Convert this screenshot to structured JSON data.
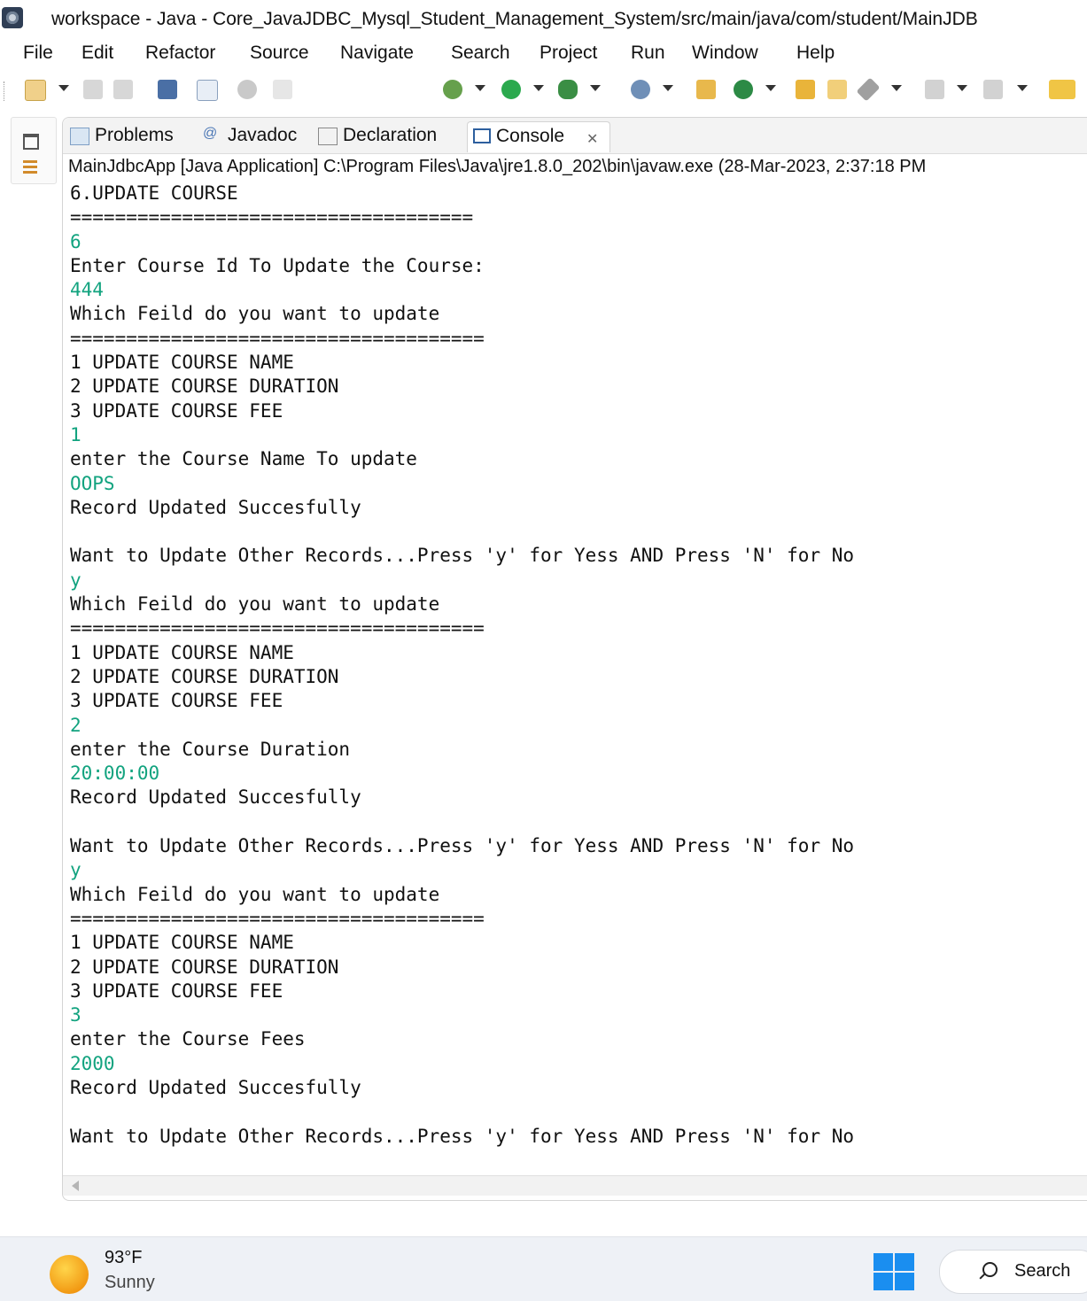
{
  "window": {
    "title": "workspace - Java - Core_JavaJDBC_Mysql_Student_Management_System/src/main/java/com/student/MainJDB"
  },
  "menubar": [
    "File",
    "Edit",
    "Refactor",
    "Source",
    "Navigate",
    "Search",
    "Project",
    "Run",
    "Window",
    "Help"
  ],
  "toolbar": {
    "icons": [
      "new-icon",
      "save-icon",
      "save-all-icon",
      "terminal-icon",
      "skip-breakpoints-icon",
      "pin-icon",
      "annotation-icon",
      "debug-icon",
      "run-icon",
      "external-tools-icon",
      "search-icon",
      "new-java-class-icon",
      "open-type-icon",
      "open-task-icon",
      "back-icon"
    ]
  },
  "tabs": [
    {
      "label": "Problems",
      "icon": "problems-icon"
    },
    {
      "label": "Javadoc",
      "icon": "javadoc-icon"
    },
    {
      "label": "Declaration",
      "icon": "declaration-icon"
    },
    {
      "label": "Console",
      "icon": "console-icon",
      "active": true
    }
  ],
  "console": {
    "description": "MainJdbcApp [Java Application] C:\\Program Files\\Java\\jre1.8.0_202\\bin\\javaw.exe (28-Mar-2023, 2:37:18 PM",
    "lines": [
      {
        "text": "6.UPDATE COURSE",
        "type": "out"
      },
      {
        "text": "====================================",
        "type": "out"
      },
      {
        "text": "6",
        "type": "in"
      },
      {
        "text": "Enter Course Id To Update the Course:",
        "type": "out"
      },
      {
        "text": "444",
        "type": "in"
      },
      {
        "text": "Which Feild do you want to update",
        "type": "out"
      },
      {
        "text": "=====================================",
        "type": "out"
      },
      {
        "text": "1 UPDATE COURSE NAME",
        "type": "out"
      },
      {
        "text": "2 UPDATE COURSE DURATION",
        "type": "out"
      },
      {
        "text": "3 UPDATE COURSE FEE",
        "type": "out"
      },
      {
        "text": "1",
        "type": "in"
      },
      {
        "text": "enter the Course Name To update",
        "type": "out"
      },
      {
        "text": "OOPS",
        "type": "in"
      },
      {
        "text": "Record Updated Succesfully",
        "type": "out"
      },
      {
        "text": "",
        "type": "out"
      },
      {
        "text": "Want to Update Other Records...Press 'y' for Yess AND Press 'N' for No",
        "type": "out"
      },
      {
        "text": "y",
        "type": "in"
      },
      {
        "text": "Which Feild do you want to update",
        "type": "out"
      },
      {
        "text": "=====================================",
        "type": "out"
      },
      {
        "text": "1 UPDATE COURSE NAME",
        "type": "out"
      },
      {
        "text": "2 UPDATE COURSE DURATION",
        "type": "out"
      },
      {
        "text": "3 UPDATE COURSE FEE",
        "type": "out"
      },
      {
        "text": "2",
        "type": "in"
      },
      {
        "text": "enter the Course Duration",
        "type": "out"
      },
      {
        "text": "20:00:00",
        "type": "in"
      },
      {
        "text": "Record Updated Succesfully",
        "type": "out"
      },
      {
        "text": "",
        "type": "out"
      },
      {
        "text": "Want to Update Other Records...Press 'y' for Yess AND Press 'N' for No",
        "type": "out"
      },
      {
        "text": "y",
        "type": "in"
      },
      {
        "text": "Which Feild do you want to update",
        "type": "out"
      },
      {
        "text": "=====================================",
        "type": "out"
      },
      {
        "text": "1 UPDATE COURSE NAME",
        "type": "out"
      },
      {
        "text": "2 UPDATE COURSE DURATION",
        "type": "out"
      },
      {
        "text": "3 UPDATE COURSE FEE",
        "type": "out"
      },
      {
        "text": "3",
        "type": "in"
      },
      {
        "text": "enter the Course Fees",
        "type": "out"
      },
      {
        "text": "2000",
        "type": "in"
      },
      {
        "text": "Record Updated Succesfully",
        "type": "out"
      },
      {
        "text": "",
        "type": "out"
      },
      {
        "text": "Want to Update Other Records...Press 'y' for Yess AND Press 'N' for No",
        "type": "out"
      }
    ]
  },
  "taskbar": {
    "weather": {
      "temp": "93°F",
      "desc": "Sunny"
    },
    "search_label": "Search"
  },
  "colors": {
    "input_text": "#12a37f",
    "output_text": "#111111",
    "accent": "#1a8ef0"
  }
}
